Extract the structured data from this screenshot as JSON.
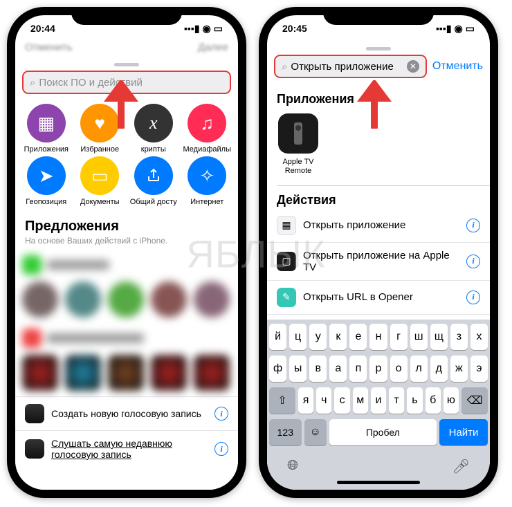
{
  "left": {
    "time": "20:44",
    "search_placeholder": "Поиск ПО и действий",
    "categories": [
      {
        "label": "Приложения",
        "color": "#8e44ad",
        "icon": "apps"
      },
      {
        "label": "Избранное",
        "color": "#ff9500",
        "icon": "heart"
      },
      {
        "label": "крипты",
        "color": "#333333",
        "icon": "x"
      },
      {
        "label": "Медиафайлы",
        "color": "#ff2d55",
        "icon": "music"
      },
      {
        "label": "Геопозиция",
        "color": "#007aff",
        "icon": "location"
      },
      {
        "label": "Документы",
        "color": "#ffcc00",
        "icon": "doc"
      },
      {
        "label": "Общий досту",
        "color": "#007aff",
        "icon": "share"
      },
      {
        "label": "Интернет",
        "color": "#007aff",
        "icon": "compass"
      }
    ],
    "suggestions_title": "Предложения",
    "suggestions_subtitle": "На основе Ваших действий с iPhone.",
    "bottom_items": [
      "Создать новую голосовую запись",
      "Слушать самую недавнюю голосовую запись"
    ]
  },
  "right": {
    "time": "20:45",
    "search_value": "Открыть приложение",
    "cancel": "Отменить",
    "apps_title": "Приложения",
    "app_result": "Apple TV Remote",
    "actions_title": "Действия",
    "actions": [
      {
        "label": "Открыть приложение",
        "icon": "grid",
        "bg": "#f2f2f7"
      },
      {
        "label": "Открыть приложение на Apple TV",
        "icon": "tv",
        "bg": "#1c1c1e"
      },
      {
        "label": "Открыть URL в Opener",
        "icon": "pencil",
        "bg": "#34c7b6"
      }
    ],
    "keyboard": {
      "row1": [
        "й",
        "ц",
        "у",
        "к",
        "е",
        "н",
        "г",
        "ш",
        "щ",
        "з",
        "х"
      ],
      "row2": [
        "ф",
        "ы",
        "в",
        "а",
        "п",
        "р",
        "о",
        "л",
        "д",
        "ж",
        "э"
      ],
      "row3": [
        "я",
        "ч",
        "с",
        "м",
        "и",
        "т",
        "ь",
        "б",
        "ю"
      ],
      "num": "123",
      "space": "Пробел",
      "find": "Найти"
    }
  },
  "watermark": "ЯБЛЫК"
}
